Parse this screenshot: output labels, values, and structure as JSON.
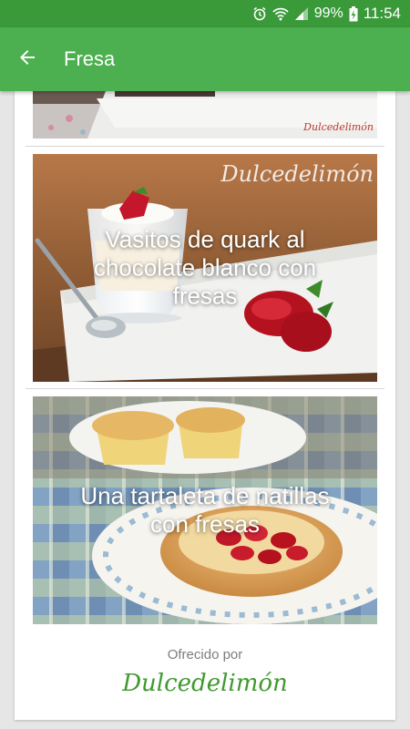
{
  "status": {
    "battery": "99%",
    "time": "11:54"
  },
  "appbar": {
    "title": "Fresa",
    "back_icon": "arrow-left-icon"
  },
  "recipes": [
    {
      "title": "",
      "watermark": "Dulcedelimón"
    },
    {
      "title": "Vasitos de quark al chocolate blanco con fresas",
      "watermark": "Dulcedelimón"
    },
    {
      "title": "Una tartaleta de natillas con fresas"
    }
  ],
  "footer": {
    "offered_by": "Ofrecido por",
    "brand": "Dulcedelimón"
  },
  "colors": {
    "primary": "#4caf50",
    "status": "#3a9a3a",
    "brand_green": "#3f9a2e"
  }
}
